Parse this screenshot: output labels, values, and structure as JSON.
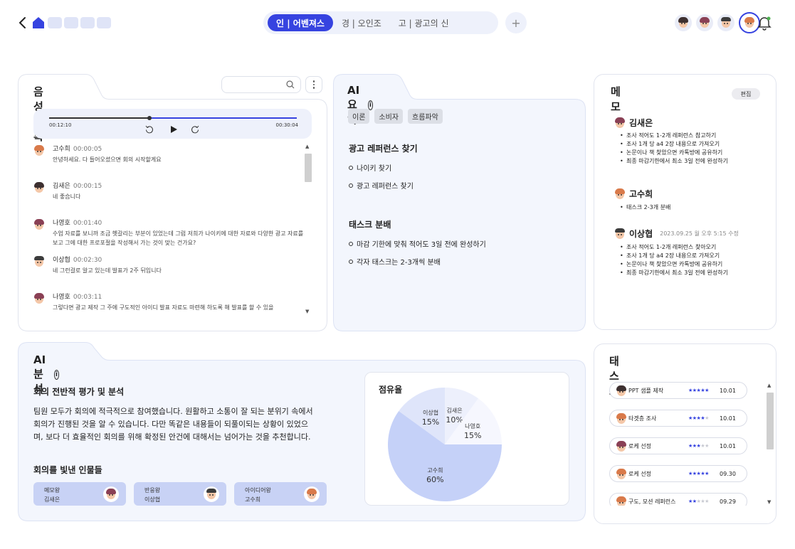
{
  "header": {
    "tabs": [
      {
        "label": "인 | 어벤져스",
        "active": true
      },
      {
        "label": "경 | 오인조",
        "active": false
      },
      {
        "label": "고 | 광고의 신",
        "active": false
      }
    ],
    "add_label": "+",
    "accent_color": "#3643e0"
  },
  "voice": {
    "title": "음성 기록",
    "player": {
      "current": "00:12:10",
      "total": "00:30:04",
      "progress": 0.405
    },
    "messages": [
      {
        "name": "고수희",
        "time": "00:00:05",
        "text": "안녕하세요. 다 들어오셨으면 회의 시작할게요"
      },
      {
        "name": "김새은",
        "time": "00:00:15",
        "text": "네 좋습니다"
      },
      {
        "name": "나영호",
        "time": "00:01:40",
        "text": "수업 자료를 보니까 조금 헷갈리는 부분이 있었는데 그럼 저희가 나이키에 대한 자료와 다양한 광고 자료를 보고 그에 대한 프로포절을 작성해서 가는 것이 맞는 건가요?"
      },
      {
        "name": "이상협",
        "time": "00:02:30",
        "text": "네 그런걸로 알고 있는데 발표가 2주 뒤입니다"
      },
      {
        "name": "나영호",
        "time": "00:03:11",
        "text": "그렇다면 광고 제작 그 주에 구도적인 아이디 발표 자료도 마련해 하도록 해 발표를 할 수 있을"
      }
    ]
  },
  "summary": {
    "title": "AI 요약",
    "chips": [
      "이론",
      "소비자",
      "흐름파악"
    ],
    "sections": [
      {
        "heading": "광고 레퍼런스 찾기",
        "items": [
          "나이키 찾기",
          "광고 레퍼런스 찾기"
        ]
      },
      {
        "heading": "태스크 분배",
        "items": [
          "마감 기한에 맞춰 적어도 3일 전에 완성하기",
          "각자 태스크는 2-3개씩 분배"
        ]
      }
    ]
  },
  "memo": {
    "title": "메모",
    "edit_label": "편집",
    "entries": [
      {
        "name": "김새은",
        "timestamp": "",
        "items": [
          "조사 적어도 1-2개 레퍼런스 참고하기",
          "조사 1개 당 a4 2장 내용으로 가져오기",
          "논문이나 책 찾았으면 카톡방에 공유하기",
          "최종 마감기한에서 최소 3일 전에 완성하기"
        ]
      },
      {
        "name": "고수희",
        "timestamp": "",
        "items": [
          "태스크 2-3개 분배"
        ]
      },
      {
        "name": "이상협",
        "timestamp": "2023.09.25 월 오후 5:15 수정",
        "items": [
          "조사 적어도 1-2개 레퍼런스 찾아오기",
          "조사 1개 당 a4 2장 내용으로 가져오기",
          "논문이나 책 찾았으면 카톡방에 공유하기",
          "최종 마감기한에서 최소 3일 전에 완성하기"
        ]
      }
    ]
  },
  "analysis": {
    "title": "AI 분석",
    "heading": "회의 전반적 평가 및 분석",
    "paragraph": "팀원 모두가 회의에 적극적으로 참여했습니다. 원활하고 소통이 잘 되는 분위기 속에서 회의가 진행된 것을 알 수 있습니다. 다만 똑같은 내용들이 되풀이되는 상황이 있었으며, 보다 더 효율적인 회의를 위해 확정된 안건에 대해서는 넘어가는 것을 추천합니다.",
    "highlight_heading": "회의를 빛낸 인물들",
    "awards": [
      {
        "role": "메모왕",
        "name": "김새은"
      },
      {
        "role": "반응왕",
        "name": "이상협"
      },
      {
        "role": "아이디어왕",
        "name": "고수희"
      }
    ]
  },
  "chart_data": {
    "type": "pie",
    "title": "점유율",
    "slices": [
      {
        "label": "고수희",
        "value": 60,
        "display": "60%",
        "color": "#c5d1f8"
      },
      {
        "label": "이상협",
        "value": 15,
        "display": "15%",
        "color": "#dfe5fa"
      },
      {
        "label": "김새은",
        "value": 10,
        "display": "10%",
        "color": "#edf0fc"
      },
      {
        "label": "나영호",
        "value": 15,
        "display": "15%",
        "color": "#f6f7fe"
      }
    ]
  },
  "tasks": {
    "title": "태스크",
    "items": [
      {
        "name": "PPT 샘플 제작",
        "rating": 5,
        "date": "10.01"
      },
      {
        "name": "타겟층 조사",
        "rating": 4,
        "date": "10.01"
      },
      {
        "name": "로케 선정",
        "rating": 3,
        "date": "10.01"
      },
      {
        "name": "로케 선정",
        "rating": 5,
        "date": "09.30"
      },
      {
        "name": "구도, 모션 레퍼런스",
        "rating": 2,
        "date": "09.29"
      }
    ]
  }
}
